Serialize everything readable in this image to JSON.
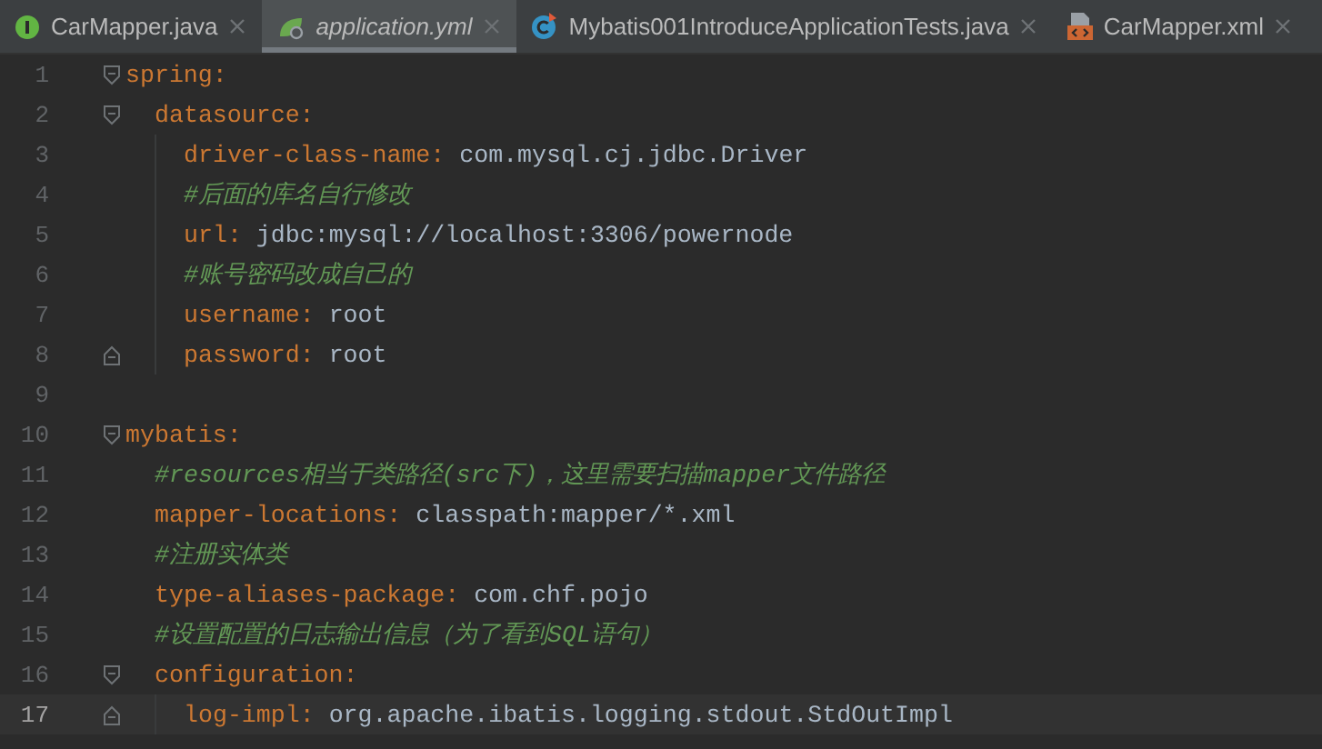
{
  "tabs": [
    {
      "label": "CarMapper.java",
      "kind": "interface",
      "selected": false
    },
    {
      "label": "application.yml",
      "kind": "spring",
      "selected": true
    },
    {
      "label": "Mybatis001IntroduceApplicationTests.java",
      "kind": "test-class",
      "selected": false
    },
    {
      "label": "CarMapper.xml",
      "kind": "xml",
      "selected": false
    }
  ],
  "editor": {
    "lines": [
      {
        "number": "1",
        "kind": "entry",
        "key": "spring:",
        "fold": {
          "kind": "start"
        },
        "children": [
          {
            "number": "2",
            "kind": "entry",
            "key": "datasource:",
            "fold": {
              "kind": "start"
            },
            "children": [
              {
                "number": "3",
                "kind": "entry",
                "key": "driver-class-name:",
                "value": "com.mysql.cj.jdbc.Driver"
              },
              {
                "number": "4",
                "kind": "comment",
                "text": "#后面的库名自行修改"
              },
              {
                "number": "5",
                "kind": "entry",
                "key": "url:",
                "value": "jdbc:mysql://localhost:3306/powernode"
              },
              {
                "number": "6",
                "kind": "comment",
                "text": "#账号密码改成自己的"
              },
              {
                "number": "7",
                "kind": "entry",
                "key": "username:",
                "value": "root"
              },
              {
                "number": "8",
                "kind": "entry",
                "key": "password:",
                "value": "root",
                "fold": {
                  "kind": "end"
                }
              }
            ]
          }
        ]
      },
      {
        "number": "9",
        "kind": "blank"
      },
      {
        "number": "10",
        "kind": "entry",
        "key": "mybatis:",
        "fold": {
          "kind": "start"
        },
        "children": [
          {
            "number": "11",
            "kind": "comment",
            "text": "#resources相当于类路径(src下)，这里需要扫描mapper文件路径"
          },
          {
            "number": "12",
            "kind": "entry",
            "key": "mapper-locations:",
            "value": "classpath:mapper/*.xml"
          },
          {
            "number": "13",
            "kind": "comment",
            "text": "#注册实体类"
          },
          {
            "number": "14",
            "kind": "entry",
            "key": "type-aliases-package:",
            "value": "com.chf.pojo"
          },
          {
            "number": "15",
            "kind": "comment",
            "text": "#设置配置的日志输出信息（为了看到SQL语句）"
          },
          {
            "number": "16",
            "kind": "entry",
            "key": "configuration:",
            "fold": {
              "kind": "start"
            },
            "children": [
              {
                "number": "17",
                "kind": "entry",
                "key": "log-impl:",
                "value": "org.apache.ibatis.logging.stdout.StdOutImpl",
                "fold": {
                  "kind": "end"
                },
                "current": true
              }
            ]
          }
        ]
      }
    ]
  }
}
